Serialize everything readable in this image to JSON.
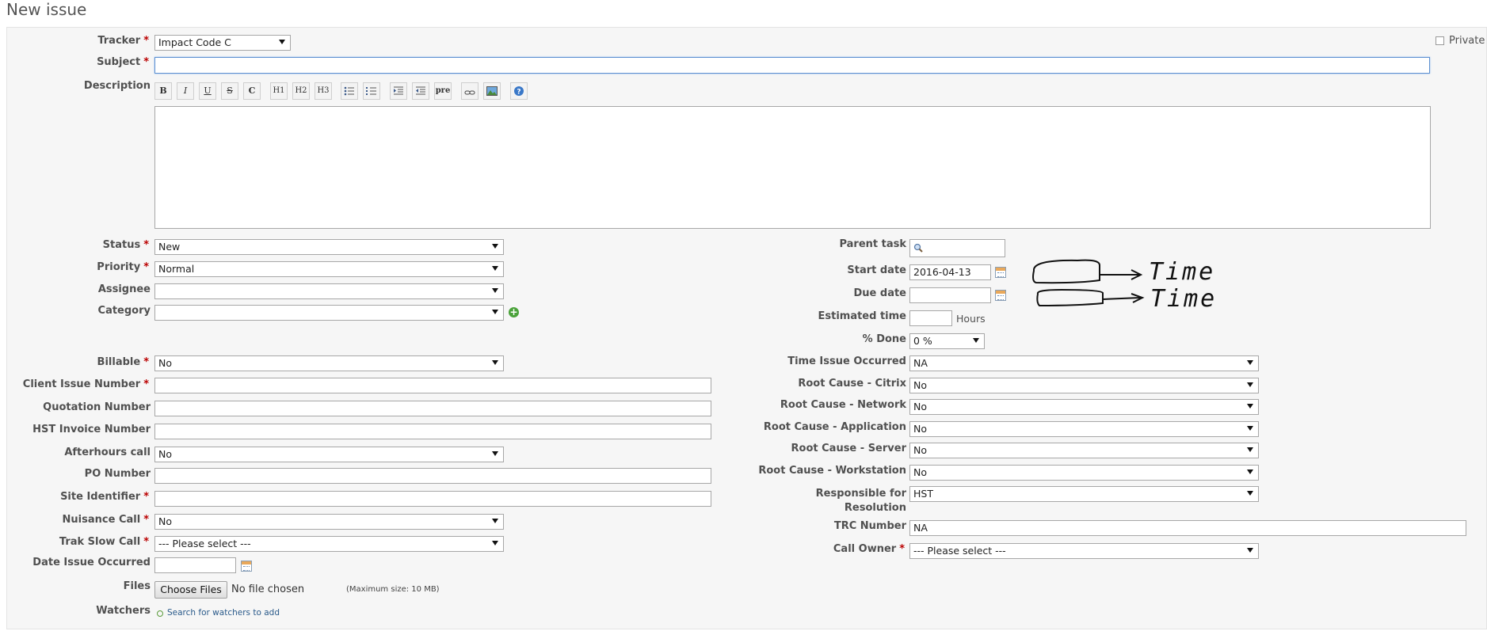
{
  "page": {
    "title": "New issue"
  },
  "form": {
    "private_label": "Private",
    "tracker": {
      "label": "Tracker",
      "value": "Impact Code C"
    },
    "subject": {
      "label": "Subject",
      "value": ""
    },
    "description": {
      "label": "Description",
      "toolbar": [
        {
          "name": "bold-button",
          "label": "B"
        },
        {
          "name": "italic-button",
          "label": "I"
        },
        {
          "name": "underline-button",
          "label": "U"
        },
        {
          "name": "strike-button",
          "label": "S"
        },
        {
          "name": "code-button",
          "label": "C"
        },
        {
          "name": "h1-button",
          "label": "H1"
        },
        {
          "name": "h2-button",
          "label": "H2"
        },
        {
          "name": "h3-button",
          "label": "H3"
        },
        {
          "name": "ul-button",
          "label": ""
        },
        {
          "name": "ol-button",
          "label": ""
        },
        {
          "name": "indent-button",
          "label": ""
        },
        {
          "name": "outdent-button",
          "label": ""
        },
        {
          "name": "pre-button",
          "label": "pre"
        },
        {
          "name": "link-button",
          "label": ""
        },
        {
          "name": "image-button",
          "label": ""
        },
        {
          "name": "help-button",
          "label": ""
        }
      ]
    },
    "left": {
      "status": {
        "label": "Status",
        "value": "New"
      },
      "priority": {
        "label": "Priority",
        "value": "Normal"
      },
      "assignee": {
        "label": "Assignee",
        "value": ""
      },
      "category": {
        "label": "Category",
        "value": ""
      },
      "billable": {
        "label": "Billable",
        "value": "No"
      },
      "client_issue_number": {
        "label": "Client Issue Number",
        "value": ""
      },
      "quotation_number": {
        "label": "Quotation Number",
        "value": ""
      },
      "hst_invoice_number": {
        "label": "HST Invoice Number",
        "value": ""
      },
      "afterhours_call": {
        "label": "Afterhours call",
        "value": "No"
      },
      "po_number": {
        "label": "PO Number",
        "value": ""
      },
      "site_identifier": {
        "label": "Site Identifier",
        "value": ""
      },
      "nuisance_call": {
        "label": "Nuisance Call",
        "value": "No"
      },
      "trak_slow_call": {
        "label": "Trak Slow Call",
        "value": "--- Please select ---"
      },
      "date_issue_occurred": {
        "label": "Date Issue Occurred",
        "value": ""
      },
      "files": {
        "label": "Files",
        "button": "Choose Files",
        "status": "No file chosen",
        "max_size": "(Maximum size: 10 MB)"
      },
      "watchers": {
        "label": "Watchers",
        "link": "Search for watchers to add"
      }
    },
    "right": {
      "parent_task": {
        "label": "Parent task",
        "value": ""
      },
      "start_date": {
        "label": "Start date",
        "value": "2016-04-13"
      },
      "due_date": {
        "label": "Due date",
        "value": ""
      },
      "estimated_time": {
        "label": "Estimated time",
        "value": "",
        "unit": "Hours"
      },
      "done": {
        "label": "% Done",
        "value": "0 %"
      },
      "time_issue_occurred": {
        "label": "Time Issue Occurred",
        "value": "NA"
      },
      "root_cause_citrix": {
        "label": "Root Cause - Citrix",
        "value": "No"
      },
      "root_cause_network": {
        "label": "Root Cause - Network",
        "value": "No"
      },
      "root_cause_application": {
        "label": "Root Cause - Application",
        "value": "No"
      },
      "root_cause_server": {
        "label": "Root Cause - Server",
        "value": "No"
      },
      "root_cause_workstation": {
        "label": "Root Cause - Workstation",
        "value": "No"
      },
      "responsible_for_resolution": {
        "label_line1": "Responsible for",
        "label_line2": "Resolution",
        "value": "HST"
      },
      "trc_number": {
        "label": "TRC Number",
        "value": "NA"
      },
      "call_owner": {
        "label": "Call Owner",
        "value": "--- Please select ---"
      }
    },
    "annotations": {
      "start_time_note": "Time",
      "due_time_note": "Time"
    }
  }
}
